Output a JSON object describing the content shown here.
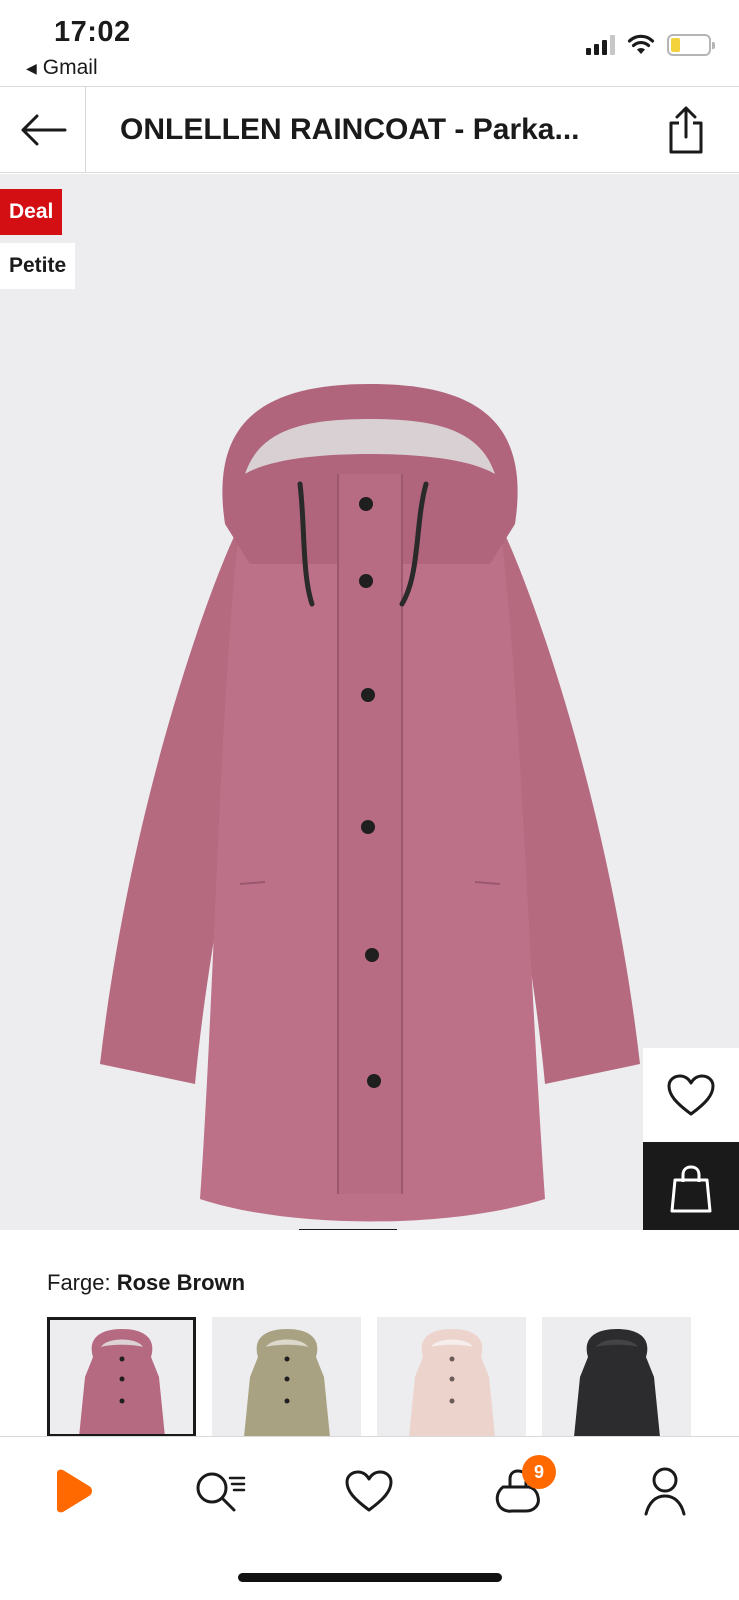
{
  "status_bar": {
    "time": "17:02",
    "back_app": "Gmail",
    "back_icon": "triangle-left-icon",
    "icons": [
      "signal-icon",
      "wifi-icon",
      "battery-icon"
    ]
  },
  "header": {
    "back_icon": "arrow-left-icon",
    "title": "ONLELLEN RAINCOAT - Parka...",
    "share_icon": "share-icon"
  },
  "hero": {
    "badges": [
      {
        "label": "Deal",
        "color": "#d40f14"
      },
      {
        "label": "Petite",
        "color": "#ffffff"
      }
    ],
    "wishlist_icon": "heart-icon",
    "add_to_bag_icon": "shopping-bag-icon"
  },
  "colors": {
    "label": "Farge:",
    "selected": "Rose Brown",
    "swatches": [
      {
        "name": "rose-brown",
        "hex": "#b56a82",
        "selected": true
      },
      {
        "name": "olive",
        "hex": "#a8a283",
        "selected": false
      },
      {
        "name": "light-pink",
        "hex": "#ecd3cc",
        "selected": false
      },
      {
        "name": "black",
        "hex": "#2c2c2e",
        "selected": false
      }
    ]
  },
  "bottom_nav": {
    "items": [
      "home-icon",
      "search-icon",
      "heart-icon",
      "bag-icon",
      "profile-icon"
    ],
    "bag_count": "9",
    "accent": "#ff6900"
  }
}
